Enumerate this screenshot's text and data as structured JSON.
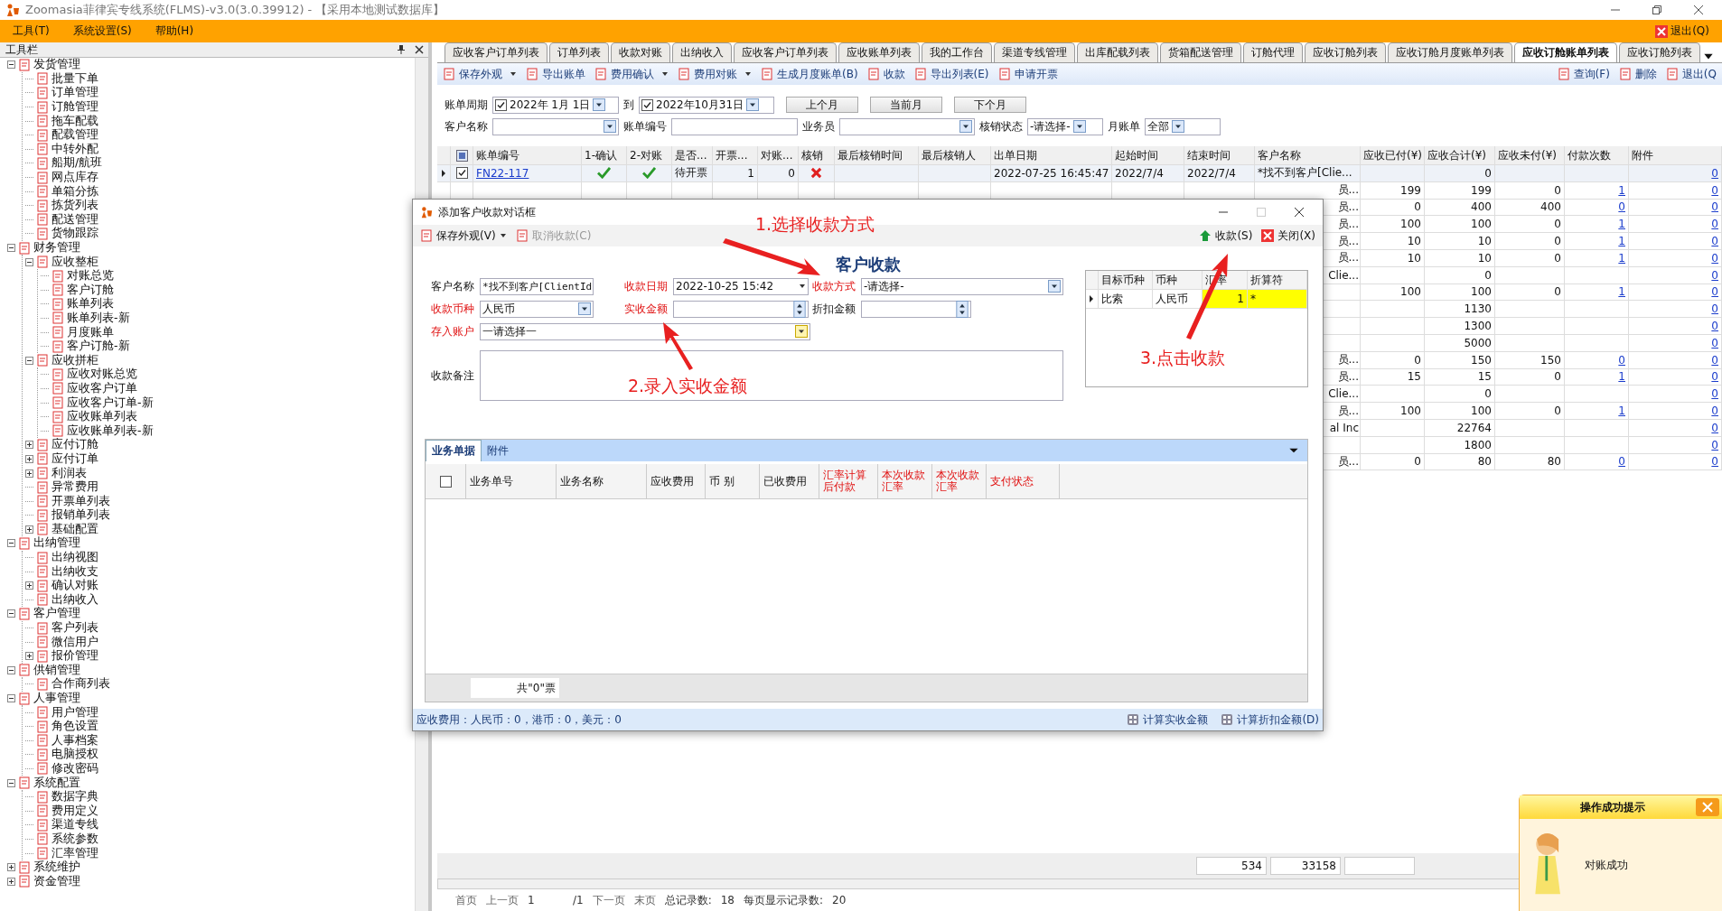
{
  "window": {
    "title": "Zoomasia菲律宾专线系统(FLMS)-v3.0(3.0.39912) - 【采用本地测试数据库】"
  },
  "menu": {
    "items": [
      "工具(T)",
      "系统设置(S)",
      "帮助(H)"
    ],
    "exit": "退出(Q)"
  },
  "sidebar": {
    "title": "工具栏",
    "tree": [
      {
        "label": "发货管理",
        "expanded": true,
        "children": [
          {
            "label": "批量下单"
          },
          {
            "label": "订单管理"
          },
          {
            "label": "订舱管理"
          },
          {
            "label": "拖车配载"
          },
          {
            "label": "配载管理"
          },
          {
            "label": "中转外配"
          },
          {
            "label": "船期/航班"
          },
          {
            "label": "网点库存"
          },
          {
            "label": "单箱分拣"
          },
          {
            "label": "拣货列表"
          },
          {
            "label": "配送管理"
          },
          {
            "label": "货物跟踪"
          }
        ]
      },
      {
        "label": "财务管理",
        "expanded": true,
        "children": [
          {
            "label": "应收整柜",
            "expanded": true,
            "children": [
              {
                "label": "对账总览"
              },
              {
                "label": "客户订舱"
              },
              {
                "label": "账单列表"
              },
              {
                "label": "账单列表-新"
              },
              {
                "label": "月度账单"
              },
              {
                "label": "客户订舱-新"
              }
            ]
          },
          {
            "label": "应收拼柜",
            "expanded": true,
            "children": [
              {
                "label": "应收对账总览"
              },
              {
                "label": "应收客户订单"
              },
              {
                "label": "应收客户订单-新"
              },
              {
                "label": "应收账单列表"
              },
              {
                "label": "应收账单列表-新"
              }
            ]
          },
          {
            "label": "应付订舱",
            "expanded": false
          },
          {
            "label": "应付订单",
            "expanded": false
          },
          {
            "label": "利润表",
            "expanded": false
          },
          {
            "label": "异常费用"
          },
          {
            "label": "开票单列表"
          },
          {
            "label": "报销单列表"
          },
          {
            "label": "基础配置",
            "expanded": false
          }
        ]
      },
      {
        "label": "出纳管理",
        "expanded": true,
        "children": [
          {
            "label": "出纳视图"
          },
          {
            "label": "出纳收支"
          },
          {
            "label": "确认对账",
            "expanded": false
          },
          {
            "label": "出纳收入"
          }
        ]
      },
      {
        "label": "客户管理",
        "expanded": true,
        "children": [
          {
            "label": "客户列表"
          },
          {
            "label": "微信用户"
          },
          {
            "label": "报价管理",
            "expanded": false
          }
        ]
      },
      {
        "label": "供销管理",
        "expanded": true,
        "children": [
          {
            "label": "合作商列表"
          }
        ]
      },
      {
        "label": "人事管理",
        "expanded": true,
        "children": [
          {
            "label": "用户管理"
          },
          {
            "label": "角色设置"
          },
          {
            "label": "人事档案"
          },
          {
            "label": "电脑授权"
          },
          {
            "label": "修改密码"
          }
        ]
      },
      {
        "label": "系统配置",
        "expanded": true,
        "children": [
          {
            "label": "数据字典"
          },
          {
            "label": "费用定义"
          },
          {
            "label": "渠道专线"
          },
          {
            "label": "系统参数"
          },
          {
            "label": "汇率管理"
          }
        ]
      },
      {
        "label": "系统维护",
        "expanded": false
      },
      {
        "label": "资金管理",
        "expanded": false
      }
    ]
  },
  "tabs": [
    {
      "label": "应收客户订单列表",
      "selected": false
    },
    {
      "label": "订单列表",
      "selected": false
    },
    {
      "label": "收款对账",
      "selected": false
    },
    {
      "label": "出纳收入",
      "selected": false
    },
    {
      "label": "应收客户订单列表",
      "selected": false
    },
    {
      "label": "应收账单列表",
      "selected": false
    },
    {
      "label": "我的工作台",
      "selected": false
    },
    {
      "label": "渠道专线管理",
      "selected": false
    },
    {
      "label": "出库配载列表",
      "selected": false
    },
    {
      "label": "货箱配送管理",
      "selected": false
    },
    {
      "label": "订舱代理",
      "selected": false
    },
    {
      "label": "应收订舱列表",
      "selected": false
    },
    {
      "label": "应收订舱月度账单列表",
      "selected": false
    },
    {
      "label": "应收订舱账单列表",
      "selected": true
    },
    {
      "label": "应收订舱列表",
      "selected": false
    }
  ],
  "toolbar": {
    "left": [
      {
        "label": "保存外观",
        "dropdown": true
      },
      {
        "label": "导出账单",
        "dropdown": false
      },
      {
        "label": "费用确认",
        "dropdown": true
      },
      {
        "label": "费用对账",
        "dropdown": true
      },
      {
        "label": "生成月度账单(B)",
        "dropdown": false
      },
      {
        "label": "收款",
        "dropdown": false
      },
      {
        "label": "导出列表(E)",
        "dropdown": false
      },
      {
        "label": "申请开票",
        "dropdown": false
      }
    ],
    "right": [
      {
        "label": "查询(F)"
      },
      {
        "label": "删除"
      },
      {
        "label": "退出(Q"
      }
    ]
  },
  "filters": {
    "period_label": "账单周期",
    "from": {
      "checked": true,
      "value": "2022年  1月  1日"
    },
    "to_label": "到",
    "to": {
      "checked": true,
      "value": "2022年10月31日"
    },
    "buttons": [
      "上个月",
      "当前月",
      "下个月"
    ],
    "customer_label": "客户名称",
    "bill_no_label": "账单编号",
    "salesman_label": "业务员",
    "status_label": "核销状态",
    "status_value": "-请选择-",
    "monthly_label": "月账单",
    "monthly_value": "全部"
  },
  "table": {
    "columns": [
      "账单编号",
      "1-确认",
      "2-对账",
      "是否...",
      "开票...",
      "对账...",
      "核销",
      "最后核销时间",
      "最后核销人",
      "出单日期",
      "起始时间",
      "结束时间",
      "客户名称",
      "应收已付(¥)",
      "应收合计(¥)",
      "应收未付(¥)",
      "付款次数",
      "附件"
    ],
    "rows": [
      {
        "selected": true,
        "checked": true,
        "bill_no": "FN22-117",
        "confirmed": true,
        "reconciled": true,
        "invoice": "待开票",
        "invoice_count": "1",
        "recon_count": "0",
        "written_off": false,
        "issue_date": "2022-07-25 16:45:47",
        "start": "2022/7/4",
        "end": "2022/7/4",
        "customer": "*找不到客户[Clie...",
        "total": "0",
        "attachments": "0"
      },
      {
        "selected": false,
        "customer": "员...",
        "paid": "199",
        "total": "199",
        "unpaid": "0",
        "payments": "1",
        "attachments": "0"
      },
      {
        "selected": false,
        "customer": "员...",
        "paid": "0",
        "total": "400",
        "unpaid": "400",
        "payments": "0",
        "attachments": "0"
      },
      {
        "selected": false,
        "customer": "员...",
        "paid": "100",
        "total": "100",
        "unpaid": "0",
        "payments": "1",
        "attachments": "0"
      },
      {
        "selected": false,
        "customer": "员...",
        "paid": "10",
        "total": "10",
        "unpaid": "0",
        "payments": "1",
        "attachments": "0"
      },
      {
        "selected": false,
        "customer": "员...",
        "paid": "10",
        "total": "10",
        "unpaid": "0",
        "payments": "1",
        "attachments": "0"
      },
      {
        "selected": false,
        "customer": "Clie...",
        "total": "0",
        "attachments": "0"
      },
      {
        "selected": false,
        "paid": "100",
        "total": "100",
        "unpaid": "0",
        "payments": "1",
        "attachments": "0"
      },
      {
        "selected": false,
        "total": "1130",
        "attachments": "0"
      },
      {
        "selected": false,
        "total": "1300",
        "attachments": "0"
      },
      {
        "selected": false,
        "total": "5000",
        "attachments": "0"
      },
      {
        "selected": false,
        "customer": "员...",
        "paid": "0",
        "total": "150",
        "unpaid": "150",
        "payments": "0",
        "attachments": "0"
      },
      {
        "selected": false,
        "customer": "员...",
        "paid": "15",
        "total": "15",
        "unpaid": "0",
        "payments": "1",
        "attachments": "0"
      },
      {
        "selected": false,
        "customer": "Clie...",
        "total": "0",
        "attachments": "0"
      },
      {
        "selected": false,
        "customer": "员...",
        "paid": "100",
        "total": "100",
        "unpaid": "0",
        "payments": "1",
        "attachments": "0"
      },
      {
        "selected": false,
        "customer": "al Inc",
        "total": "22764",
        "attachments": "0"
      },
      {
        "selected": false,
        "total": "1800",
        "attachments": "0"
      },
      {
        "selected": false,
        "customer": "员...",
        "paid": "0",
        "total": "80",
        "unpaid": "80",
        "payments": "0",
        "attachments": "0"
      }
    ],
    "totals": [
      "534",
      "33158"
    ]
  },
  "pager": {
    "first": "首页",
    "prev": "上一页",
    "page": "1",
    "of": "/1",
    "next": "下一页",
    "last": "末页",
    "total_label": "总记录数:",
    "total": "18",
    "per_page_label": "每页显示记录数:",
    "per_page": "20"
  },
  "dialog": {
    "title": "添加客户收款对话框",
    "toolbar": [
      {
        "label": "保存外观(V)",
        "disabled": false
      },
      {
        "label": "取消收款(C)",
        "disabled": true
      }
    ],
    "collect": "收款(S)",
    "close": "关闭(X)",
    "heading": "客户收款",
    "fields": [
      {
        "label": "客户名称",
        "required": false,
        "value": "*找不到客户[ClientId"
      },
      {
        "label": "收款日期",
        "required": true,
        "value": "2022-10-25 15:42"
      },
      {
        "label": "收款方式",
        "required": true,
        "value": "-请选择-"
      },
      {
        "label": "收款币种",
        "required": true,
        "value": "人民币"
      },
      {
        "label": "实收金额",
        "required": true
      },
      {
        "label": "折扣金额",
        "required": false
      },
      {
        "label": "存入账户",
        "required": true,
        "value": "一请选择一"
      },
      {
        "label": "收款备注",
        "required": false
      }
    ],
    "rates": {
      "columns": [
        "目标币种",
        "币种",
        "汇率",
        "折算符"
      ],
      "rows": [
        [
          "比索",
          "人民币",
          "1",
          "*"
        ]
      ]
    },
    "tabs": [
      {
        "label": "业务单据",
        "selected": true
      },
      {
        "label": "附件",
        "selected": false
      }
    ],
    "select_all_checked": false,
    "columns": [
      {
        "label": "业务单号",
        "required": false
      },
      {
        "label": "业务名称",
        "required": false
      },
      {
        "label": "应收费用",
        "required": false
      },
      {
        "label": "币 别",
        "required": false
      },
      {
        "label": "已收费用",
        "required": false
      },
      {
        "label": "汇率计算后付款",
        "required": true
      },
      {
        "label": "本次收款汇率",
        "required": true
      },
      {
        "label": "本次收款汇率",
        "required": true
      },
      {
        "label": "支付状态",
        "required": true
      }
    ],
    "footer": "共\"0\"票",
    "status": "应收费用：人民币：0，港币：0，美元：0",
    "actions": [
      "计算实收金额",
      "计算折扣金额(D)"
    ]
  },
  "annotations": [
    "1.选择收款方式",
    "2.录入实收金额",
    "3.点击收款"
  ],
  "toast": {
    "title": "操作成功提示",
    "message": "对账成功"
  }
}
